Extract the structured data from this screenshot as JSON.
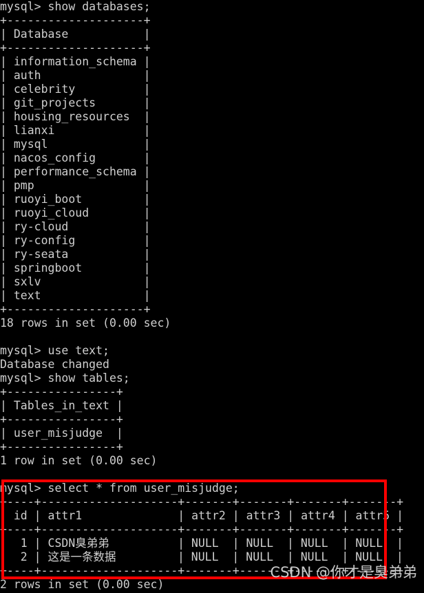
{
  "terminal": {
    "prompt": "mysql>",
    "colors": {
      "background": "#000000",
      "foreground": "#cfcfcf",
      "highlight": "#ff0000",
      "watermark": "#d8d8d8"
    },
    "lines": [
      "mysql> show databases;",
      "+--------------------+",
      "| Database           |",
      "+--------------------+",
      "| information_schema |",
      "| auth               |",
      "| celebrity          |",
      "| git_projects       |",
      "| housing_resources  |",
      "| lianxi             |",
      "| mysql              |",
      "| nacos_config       |",
      "| performance_schema |",
      "| pmp                |",
      "| ruoyi_boot         |",
      "| ruoyi_cloud        |",
      "| ry-cloud           |",
      "| ry-config          |",
      "| ry-seata           |",
      "| springboot         |",
      "| sxlv               |",
      "| text               |",
      "+--------------------+",
      "18 rows in set (0.00 sec)",
      "",
      "mysql> use text;",
      "Database changed",
      "mysql> show tables;",
      "+----------------+",
      "| Tables_in_text |",
      "+----------------+",
      "| user_misjudge  |",
      "+----------------+",
      "1 row in set (0.00 sec)",
      "",
      "mysql> select * from user_misjudge;",
      "+----+--------------------+-------+-------+-------+-------+",
      "| id | attr1              | attr2 | attr3 | attr4 | attr5 |",
      "+----+--------------------+-------+-------+-------+-------+",
      "|  1 | CSDN臭弟弟          | NULL  | NULL  | NULL  | NULL  |",
      "|  2 | 这是一条数据         | NULL  | NULL  | NULL  | NULL  |",
      "+----+--------------------+-------+-------+-------+-------+",
      "2 rows in set (0.00 sec)"
    ]
  },
  "commands": {
    "show_databases": "show databases;",
    "use_text": "use text;",
    "show_tables": "show tables;",
    "select_all": "select * from user_misjudge;"
  },
  "databases_result": {
    "column_header": "Database",
    "rows": [
      "information_schema",
      "auth",
      "celebrity",
      "git_projects",
      "housing_resources",
      "lianxi",
      "mysql",
      "nacos_config",
      "performance_schema",
      "pmp",
      "ruoyi_boot",
      "ruoyi_cloud",
      "ry-cloud",
      "ry-config",
      "ry-seata",
      "springboot",
      "sxlv",
      "text"
    ],
    "status": "18 rows in set (0.00 sec)"
  },
  "use_result": {
    "message": "Database changed"
  },
  "tables_result": {
    "column_header": "Tables_in_text",
    "rows": [
      "user_misjudge"
    ],
    "status": "1 row in set (0.00 sec)"
  },
  "select_result": {
    "columns": [
      "id",
      "attr1",
      "attr2",
      "attr3",
      "attr4",
      "attr5"
    ],
    "rows": [
      [
        "1",
        "CSDN臭弟弟",
        "NULL",
        "NULL",
        "NULL",
        "NULL"
      ],
      [
        "2",
        "这是一条数据",
        "NULL",
        "NULL",
        "NULL",
        "NULL"
      ]
    ],
    "status": "2 rows in set (0.00 sec)"
  },
  "watermark": {
    "text": "CSDN @你才是臭弟弟"
  }
}
